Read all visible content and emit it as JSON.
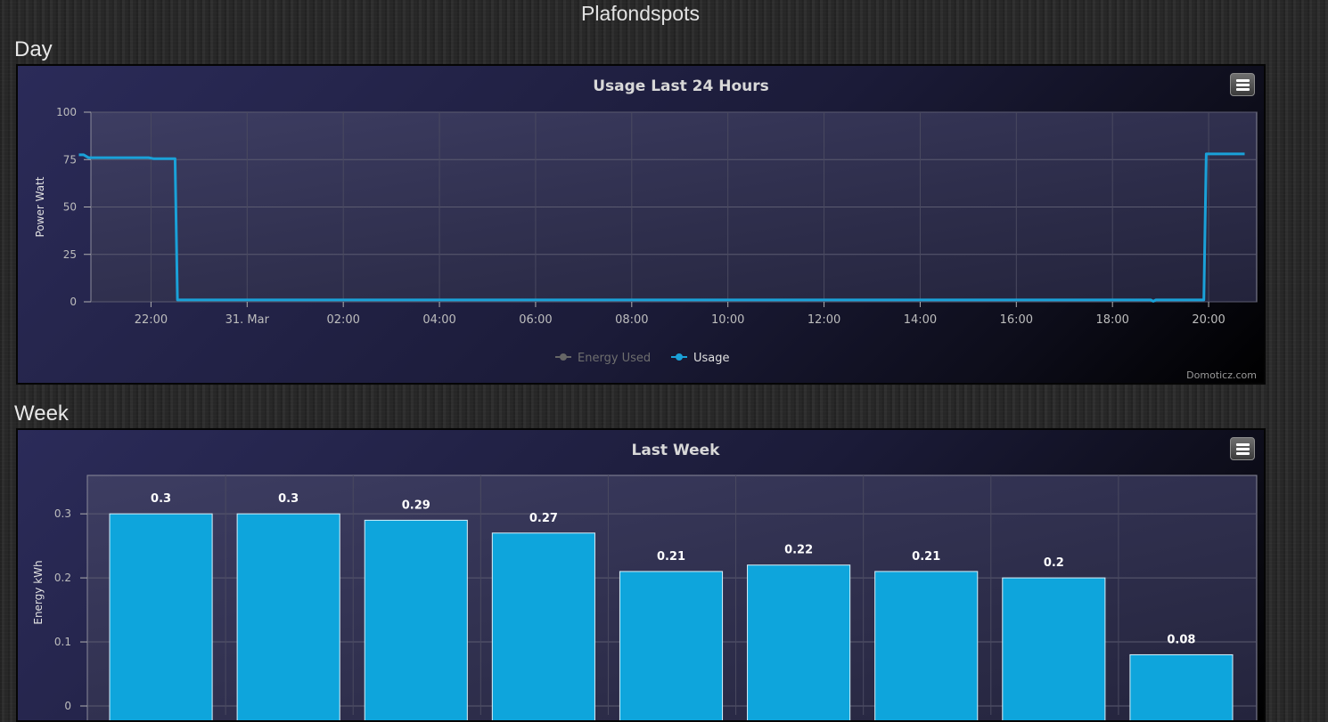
{
  "page": {
    "title": "Plafondspots"
  },
  "sections": {
    "day": "Day",
    "week": "Week"
  },
  "day_chart": {
    "credits": "Domoticz.com",
    "legend": [
      {
        "name": "Energy Used",
        "color": "#666666"
      },
      {
        "name": "Usage",
        "color": "#1aa1d8"
      }
    ]
  },
  "chart_data": [
    {
      "type": "line",
      "title": "Usage Last 24 Hours",
      "ylabel": "Power Watt",
      "xlabel": "",
      "ylim": [
        0,
        100
      ],
      "yticks": [
        0,
        25,
        50,
        75,
        100
      ],
      "xlim_hours": [
        20.75,
        45.0
      ],
      "xticks": [
        {
          "hour": 22,
          "label": "22:00"
        },
        {
          "hour": 24,
          "label": "31. Mar"
        },
        {
          "hour": 26,
          "label": "02:00"
        },
        {
          "hour": 28,
          "label": "04:00"
        },
        {
          "hour": 30,
          "label": "06:00"
        },
        {
          "hour": 32,
          "label": "08:00"
        },
        {
          "hour": 34,
          "label": "10:00"
        },
        {
          "hour": 36,
          "label": "12:00"
        },
        {
          "hour": 38,
          "label": "14:00"
        },
        {
          "hour": 40,
          "label": "16:00"
        },
        {
          "hour": 42,
          "label": "18:00"
        },
        {
          "hour": 44,
          "label": "20:00"
        }
      ],
      "grid": true,
      "legend_position": "bottom-center",
      "series": [
        {
          "name": "Usage",
          "color": "#1aa1d8",
          "points": [
            [
              20.5,
              77.5
            ],
            [
              20.6,
              77.5
            ],
            [
              20.7,
              76
            ],
            [
              21.95,
              76
            ],
            [
              22.05,
              75.5
            ],
            [
              22.5,
              75.5
            ],
            [
              22.55,
              1
            ],
            [
              42.8,
              1
            ],
            [
              42.85,
              0.3
            ],
            [
              42.9,
              1
            ],
            [
              43.9,
              1
            ],
            [
              43.95,
              78
            ],
            [
              44.75,
              78
            ]
          ]
        },
        {
          "name": "Energy Used",
          "color": "#666666",
          "points": []
        }
      ]
    },
    {
      "type": "bar",
      "title": "Last Week",
      "ylabel": "Energy kWh",
      "xlabel": "",
      "ylim": [
        0,
        0.36
      ],
      "yticks": [
        0,
        0.1,
        0.2,
        0.3
      ],
      "ytick_labels": [
        "0",
        "0.1",
        "0.2",
        "0.3"
      ],
      "grid": true,
      "color": "#0ea5dc",
      "values": [
        0.3,
        0.3,
        0.29,
        0.27,
        0.21,
        0.22,
        0.21,
        0.2,
        0.08
      ],
      "data_labels": [
        "0.3",
        "0.3",
        "0.29",
        "0.27",
        "0.21",
        "0.22",
        "0.21",
        "0.2",
        "0.08"
      ]
    }
  ]
}
